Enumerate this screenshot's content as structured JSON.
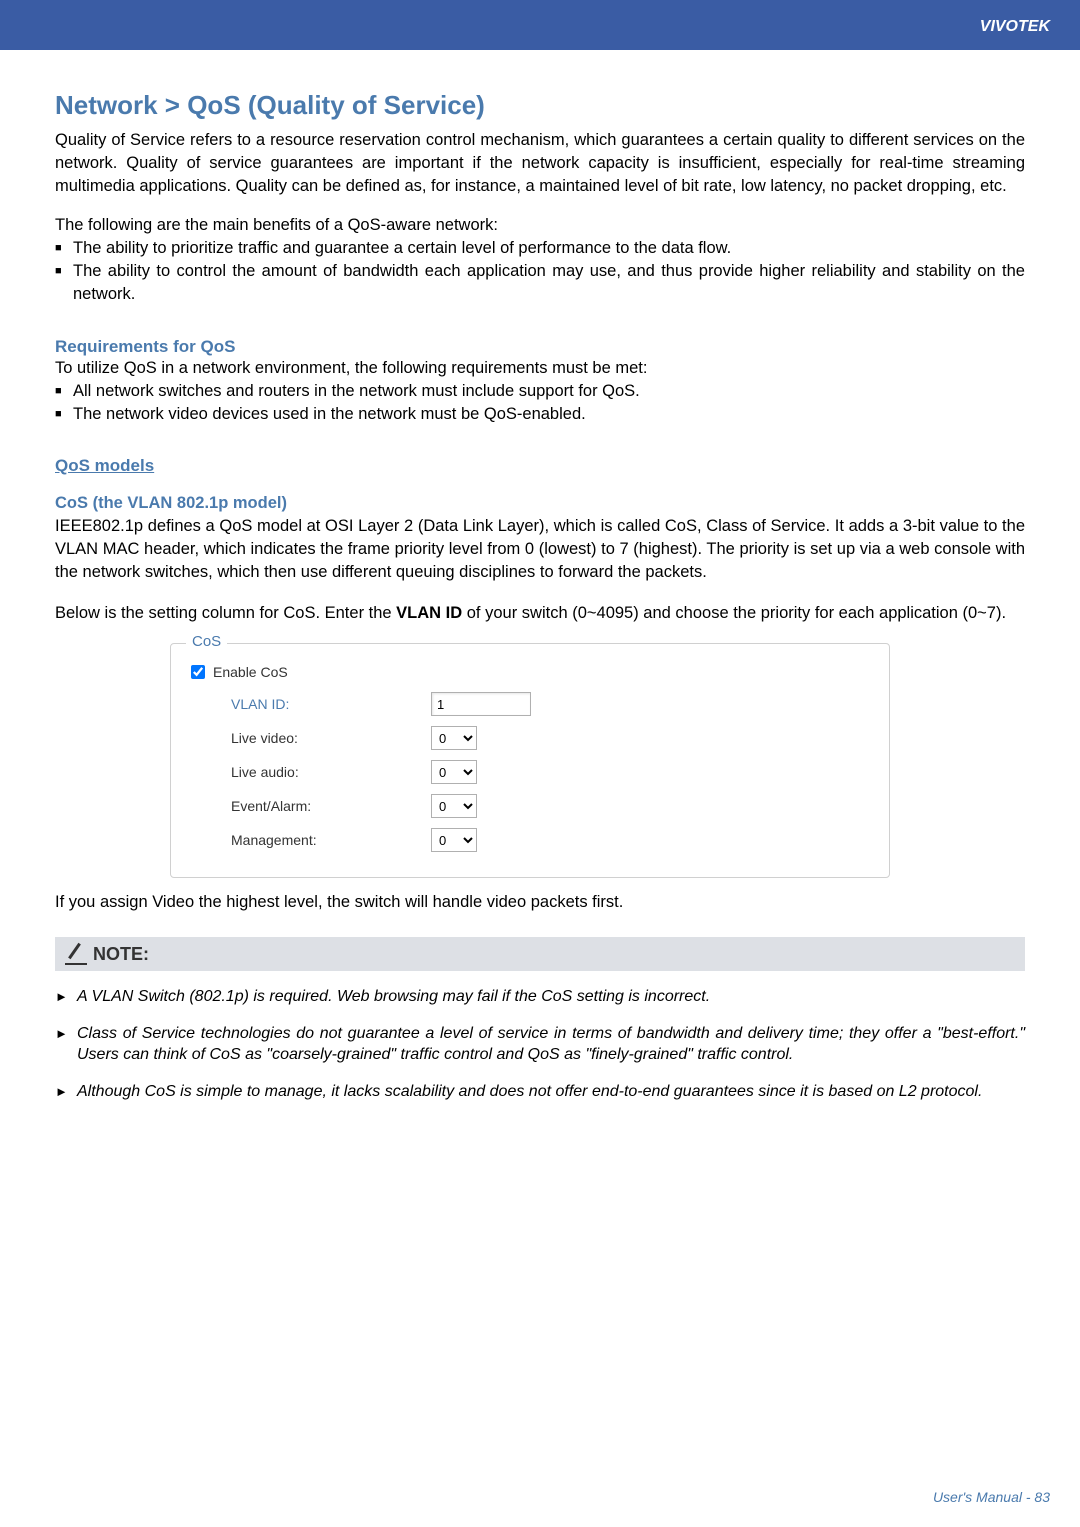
{
  "header": {
    "brand": "VIVOTEK"
  },
  "main": {
    "title": "Network > QoS (Quality of Service)",
    "intro": "Quality of Service refers to a resource reservation control mechanism, which guarantees a certain quality to different services on the network. Quality of service guarantees are important if the network capacity is insufficient, especially for real-time streaming multimedia applications. Quality can be defined as, for instance, a maintained level of bit rate, low latency, no packet dropping, etc.",
    "benefits_intro": "The following are the main benefits of a QoS-aware network:",
    "benefits": [
      "The ability to prioritize traffic and guarantee a certain level of performance to the data flow.",
      "The ability to control the amount of bandwidth each application may use, and thus provide higher reliability and stability on the network."
    ],
    "requirements": {
      "heading": "Requirements for QoS",
      "intro": "To utilize QoS in a network environment, the following requirements must be met:",
      "items": [
        "All network switches and routers in the network must include support for QoS.",
        "The network video devices used in the network must be QoS-enabled."
      ]
    },
    "qos_models_heading": "QoS models",
    "cos": {
      "heading": "CoS (the VLAN 802.1p model)",
      "description": "IEEE802.1p defines a QoS model at OSI Layer 2 (Data Link Layer), which is called CoS, Class of Service. It adds a 3-bit value to the VLAN MAC header, which indicates the frame priority level from 0 (lowest) to 7 (highest). The priority is set up via a web console with the network switches, which then use different queuing disciplines to forward the packets.",
      "settings_intro_prefix": "Below is the setting column for CoS. Enter the ",
      "settings_intro_bold": "VLAN ID",
      "settings_intro_suffix": " of your switch (0~4095) and choose the priority for each application (0~7)."
    },
    "panel": {
      "legend": "CoS",
      "enable_label": "Enable CoS",
      "fields": {
        "vlan_id": {
          "label": "VLAN ID:",
          "value": "1"
        },
        "live_video": {
          "label": "Live video:",
          "value": "0"
        },
        "live_audio": {
          "label": "Live audio:",
          "value": "0"
        },
        "event_alarm": {
          "label": "Event/Alarm:",
          "value": "0"
        },
        "management": {
          "label": "Management:",
          "value": "0"
        }
      }
    },
    "post_panel": "If you assign Video the highest level, the switch will handle video packets first.",
    "note": {
      "heading": "NOTE:",
      "items": [
        "A VLAN Switch (802.1p) is required. Web browsing may fail if the CoS setting is incorrect.",
        "Class of Service technologies do not guarantee a level of service in terms of bandwidth and delivery time; they offer a \"best-effort.\" Users can think of CoS as \"coarsely-grained\" traffic control and QoS as \"finely-grained\" traffic control.",
        "Although CoS is simple to manage, it lacks scalability and does not offer end-to-end guarantees since it is based on L2 protocol."
      ]
    }
  },
  "footer": {
    "page_label": "User's Manual - 83"
  }
}
